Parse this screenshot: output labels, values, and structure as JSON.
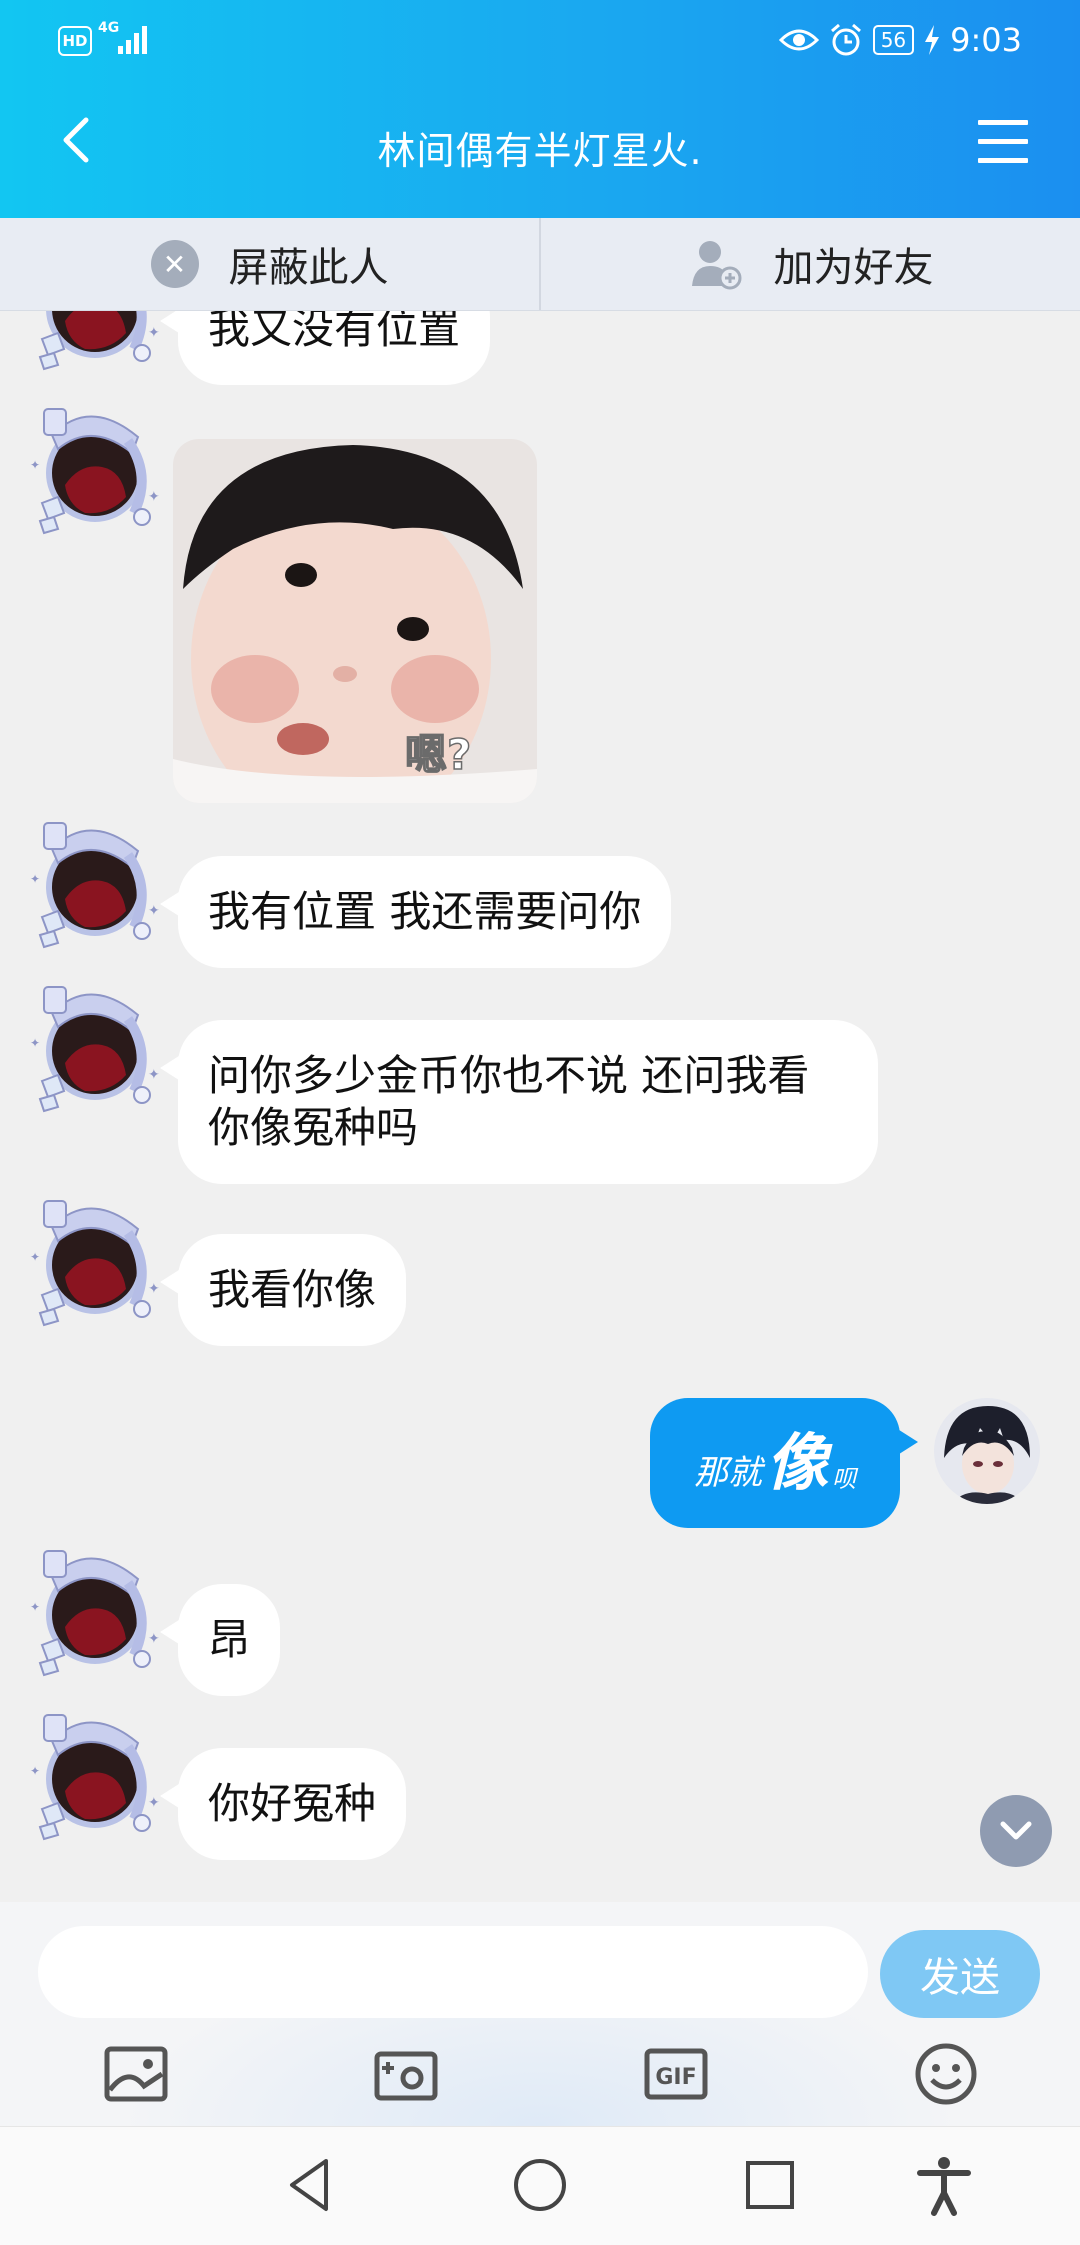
{
  "status_bar": {
    "hd": "HD",
    "network": "4G",
    "battery": "56",
    "time": "9:03"
  },
  "header": {
    "title": "林间偶有半灯星火."
  },
  "actions": {
    "block": "屏蔽此人",
    "add_friend": "加为好友"
  },
  "messages": [
    {
      "from": "other",
      "type": "text",
      "text": "我又没有位置"
    },
    {
      "from": "other",
      "type": "image",
      "caption": "嗯?"
    },
    {
      "from": "other",
      "type": "text",
      "text": "我有位置 我还需要问你"
    },
    {
      "from": "other",
      "type": "text",
      "text": "问你多少金币你也不说 还问我看\n你像冤种吗"
    },
    {
      "from": "other",
      "type": "text",
      "text": "我看你像"
    },
    {
      "from": "me",
      "type": "sticker",
      "parts": [
        "那就",
        "像",
        "呗"
      ]
    },
    {
      "from": "other",
      "type": "text",
      "text": "昂"
    },
    {
      "from": "other",
      "type": "text",
      "text": "你好冤种"
    }
  ],
  "composer": {
    "value": "",
    "send": "发送"
  },
  "toolbar_icons": [
    "photo-icon",
    "camera-icon",
    "gif-icon",
    "emoji-icon"
  ],
  "nav_icons": [
    "back-triangle-icon",
    "home-circle-icon",
    "recents-square-icon",
    "accessibility-icon"
  ],
  "colors": {
    "header_start": "#12c6f2",
    "header_end": "#1b8ff0",
    "my_bubble": "#0e9af2",
    "send_button": "#7fc8f4",
    "chat_bg": "#f0f0f0"
  }
}
